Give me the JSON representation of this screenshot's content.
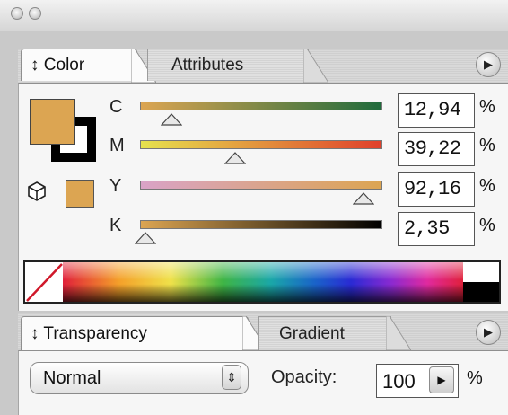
{
  "color_panel": {
    "tabs": [
      {
        "label": "↕ Color",
        "active": true
      },
      {
        "label": "Attributes",
        "active": false
      }
    ],
    "menu_icon": "play-triangle-icon",
    "fill_color": "#dca552",
    "stroke_color": "#000000",
    "channels": [
      {
        "label": "C",
        "value": "12,94",
        "unit": "%",
        "level_percent": 12.94,
        "gradient": [
          "#dca552",
          "#1f6b3c"
        ]
      },
      {
        "label": "M",
        "value": "39,22",
        "unit": "%",
        "level_percent": 39.22,
        "gradient": [
          "#e6e24e",
          "#e0402b"
        ]
      },
      {
        "label": "Y",
        "value": "92,16",
        "unit": "%",
        "level_percent": 92.16,
        "gradient": [
          "#d9a3c7",
          "#dca552"
        ]
      },
      {
        "label": "K",
        "value": "2,35",
        "unit": "%",
        "level_percent": 2.35,
        "gradient": [
          "#dca552",
          "#000000"
        ]
      }
    ]
  },
  "transparency_panel": {
    "tabs": [
      {
        "label": "↕ Transparency",
        "active": true
      },
      {
        "label": "Gradient",
        "active": false
      }
    ],
    "blend_mode": "Normal",
    "opacity_label": "Opacity:",
    "opacity_value": "100",
    "opacity_unit": "%"
  }
}
